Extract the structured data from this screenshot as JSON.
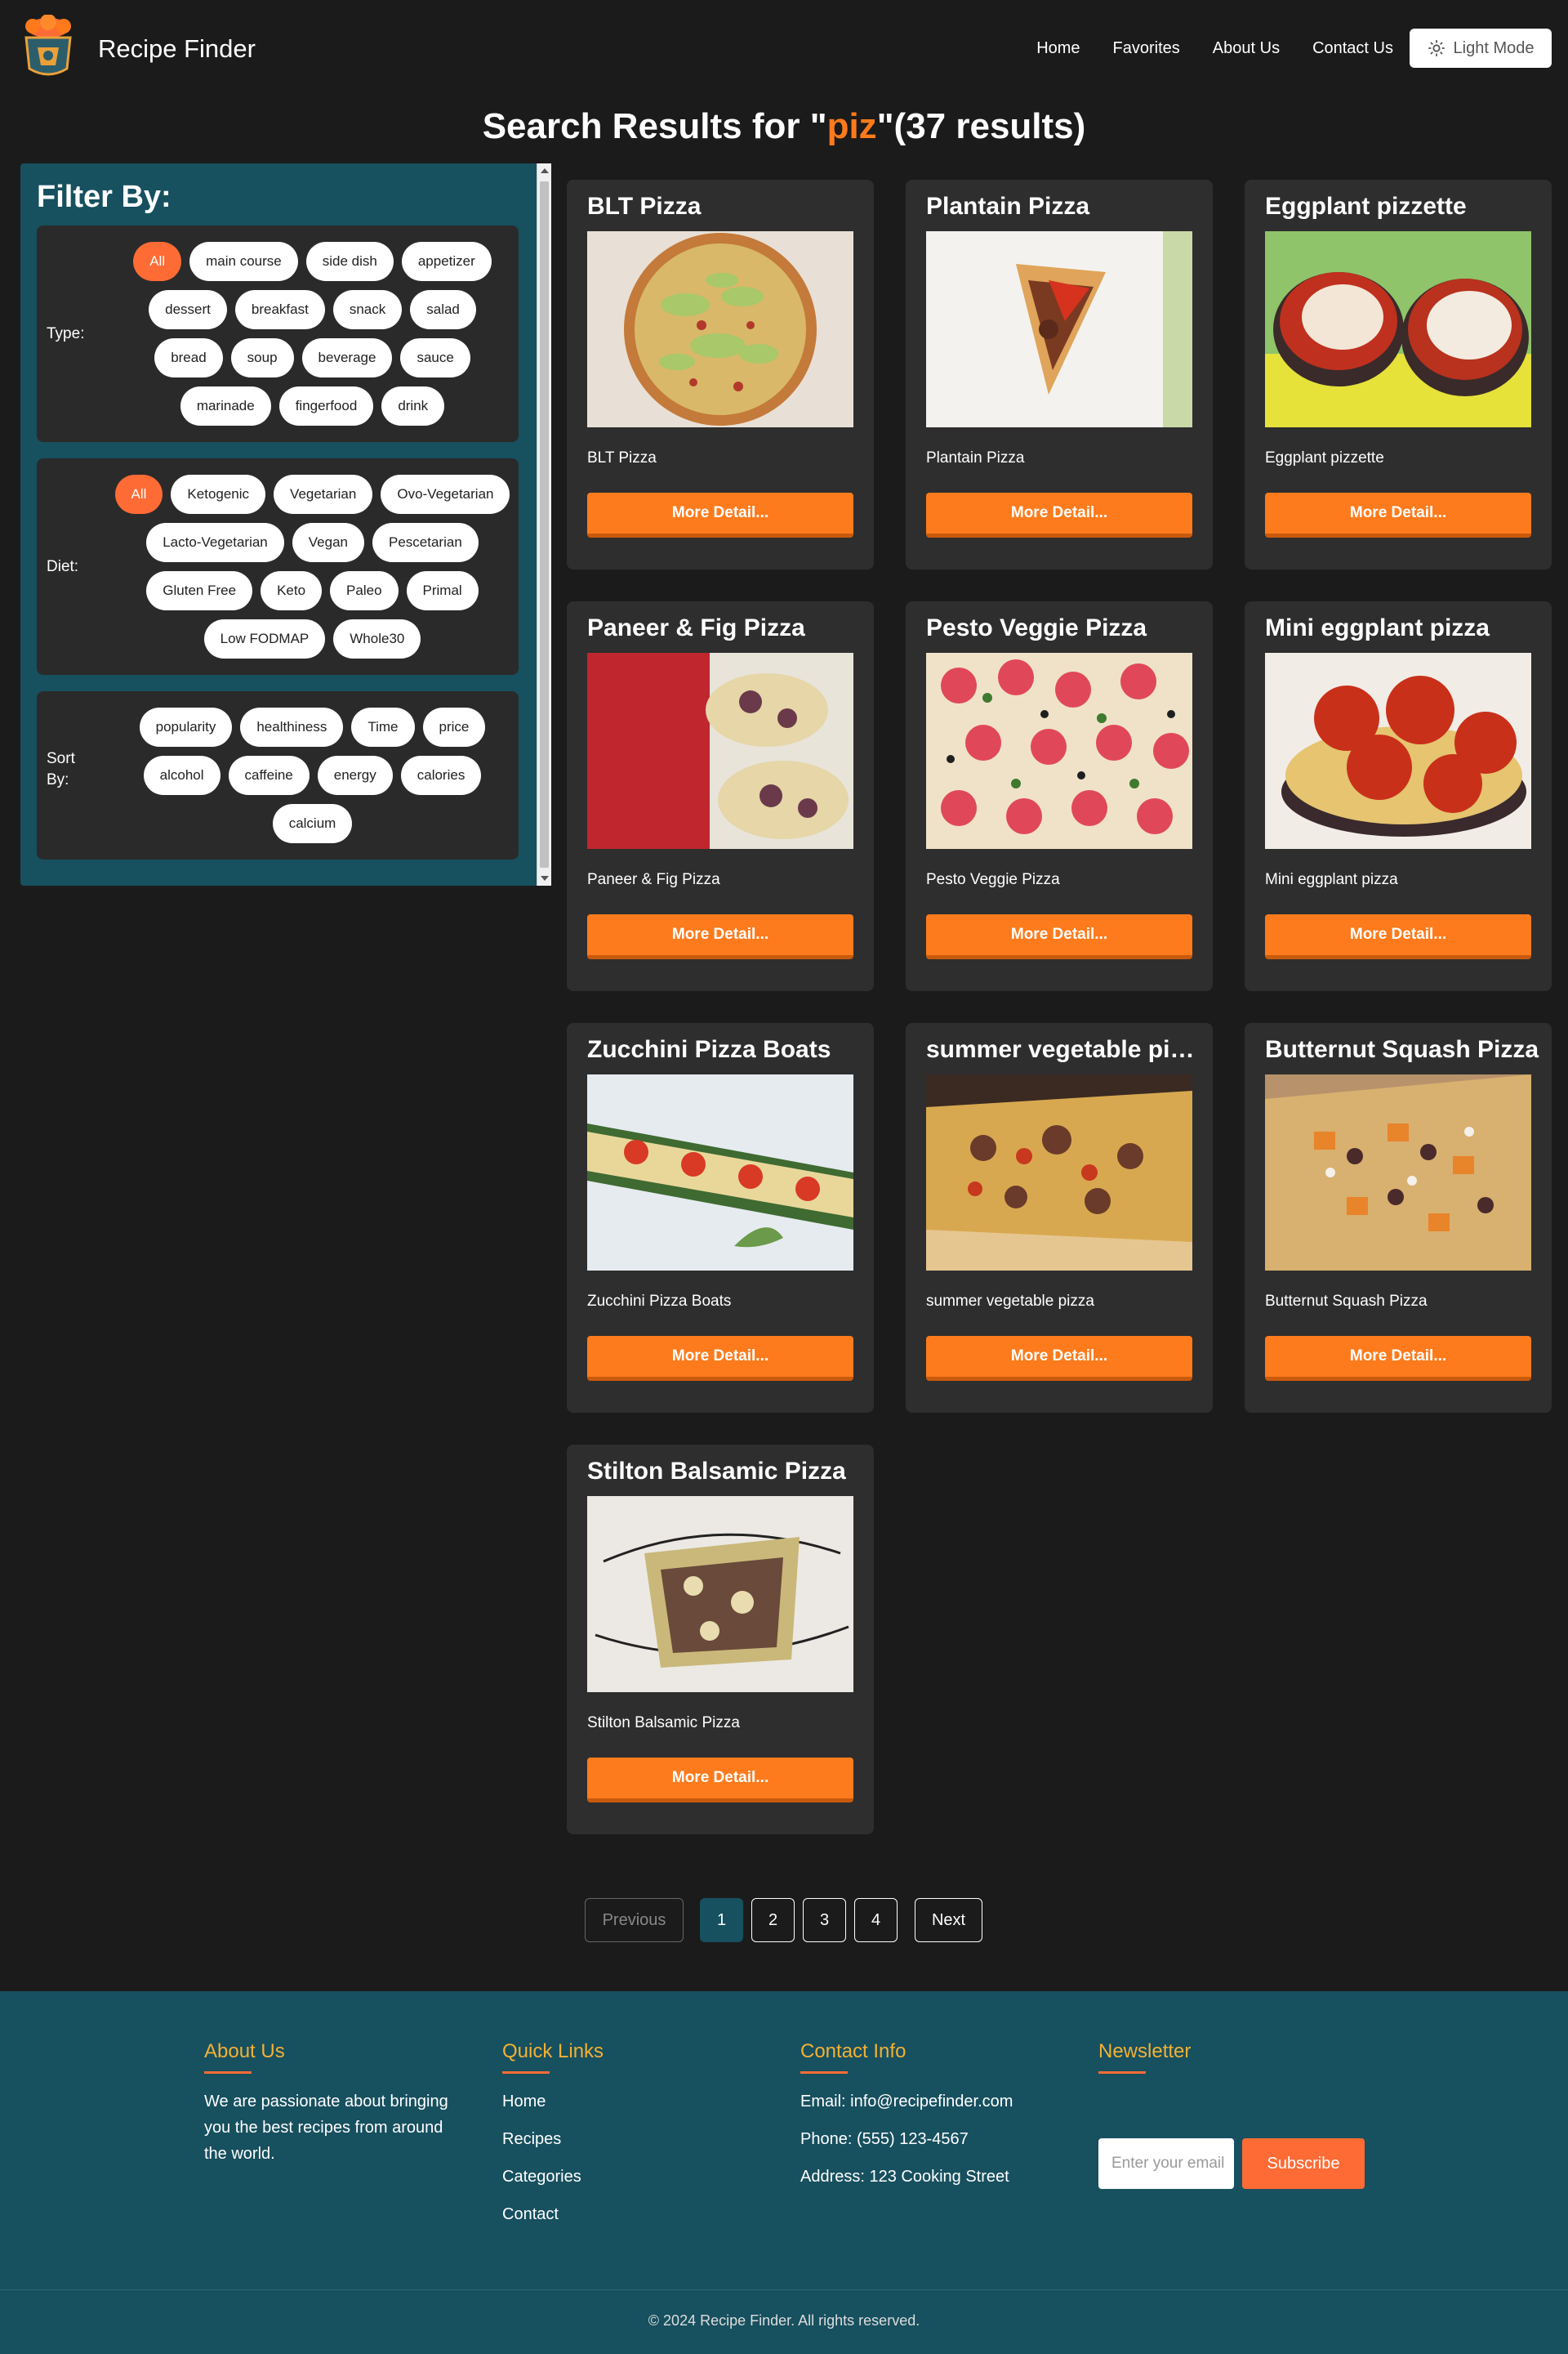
{
  "header": {
    "brand": "Recipe Finder",
    "nav": [
      "Home",
      "Favorites",
      "About Us",
      "Contact Us"
    ],
    "mode_button": "Light Mode"
  },
  "search": {
    "prefix": "Search Results for \"",
    "query": "piz",
    "suffix": "\"(37 results)"
  },
  "filters": {
    "title": "Filter By:",
    "type": {
      "label": "Type:",
      "options": [
        "All",
        "main course",
        "side dish",
        "appetizer",
        "dessert",
        "breakfast",
        "snack",
        "salad",
        "bread",
        "soup",
        "beverage",
        "sauce",
        "marinade",
        "fingerfood",
        "drink"
      ],
      "selected": "All"
    },
    "diet": {
      "label": "Diet:",
      "options": [
        "All",
        "Ketogenic",
        "Vegetarian",
        "Ovo-Vegetarian",
        "Lacto-Vegetarian",
        "Vegan",
        "Pescetarian",
        "Gluten Free",
        "Keto",
        "Paleo",
        "Primal",
        "Low FODMAP",
        "Whole30"
      ],
      "selected": "All"
    },
    "sort": {
      "label_line1": "Sort",
      "label_line2": "By:",
      "options": [
        "popularity",
        "healthiness",
        "Time",
        "price",
        "alcohol",
        "caffeine",
        "energy",
        "calories",
        "calcium"
      ]
    }
  },
  "recipes": [
    {
      "title": "BLT Pizza",
      "name": "BLT Pizza",
      "button": "More Detail..."
    },
    {
      "title": "Plantain Pizza",
      "name": "Plantain Pizza",
      "button": "More Detail..."
    },
    {
      "title": "Eggplant pizzette",
      "name": "Eggplant pizzette",
      "button": "More Detail..."
    },
    {
      "title": "Paneer & Fig Pizza",
      "name": "Paneer & Fig Pizza",
      "button": "More Detail..."
    },
    {
      "title": "Pesto Veggie Pizza",
      "name": "Pesto Veggie Pizza",
      "button": "More Detail..."
    },
    {
      "title": "Mini eggplant pizza",
      "name": "Mini eggplant pizza",
      "button": "More Detail..."
    },
    {
      "title": "Zucchini Pizza Boats",
      "name": "Zucchini Pizza Boats",
      "button": "More Detail..."
    },
    {
      "title": "summer vegetable pizza",
      "name": "summer vegetable pizza",
      "button": "More Detail..."
    },
    {
      "title": "Butternut Squash Pizza",
      "name": "Butternut Squash Pizza",
      "button": "More Detail..."
    },
    {
      "title": "Stilton Balsamic Pizza",
      "name": "Stilton Balsamic Pizza",
      "button": "More Detail..."
    }
  ],
  "pagination": {
    "previous": "Previous",
    "pages": [
      "1",
      "2",
      "3",
      "4"
    ],
    "current": "1",
    "next": "Next"
  },
  "footer": {
    "about": {
      "heading": "About Us",
      "text": "We are passionate about bringing you the best recipes from around the world."
    },
    "links": {
      "heading": "Quick Links",
      "items": [
        "Home",
        "Recipes",
        "Categories",
        "Contact"
      ]
    },
    "contact": {
      "heading": "Contact Info",
      "email": "Email: info@recipefinder.com",
      "phone": "Phone: (555) 123-4567",
      "address": "Address: 123 Cooking Street"
    },
    "newsletter": {
      "heading": "Newsletter",
      "placeholder": "Enter your email",
      "button": "Subscribe"
    },
    "copyright": "© 2024 Recipe Finder. All rights reserved."
  },
  "colors": {
    "accent": "#ff6b35",
    "button_orange": "#fd7b1c",
    "teal": "#17505f",
    "footer_heading": "#f2b134",
    "background": "#1b1b1b",
    "card": "#2e2e2e"
  }
}
